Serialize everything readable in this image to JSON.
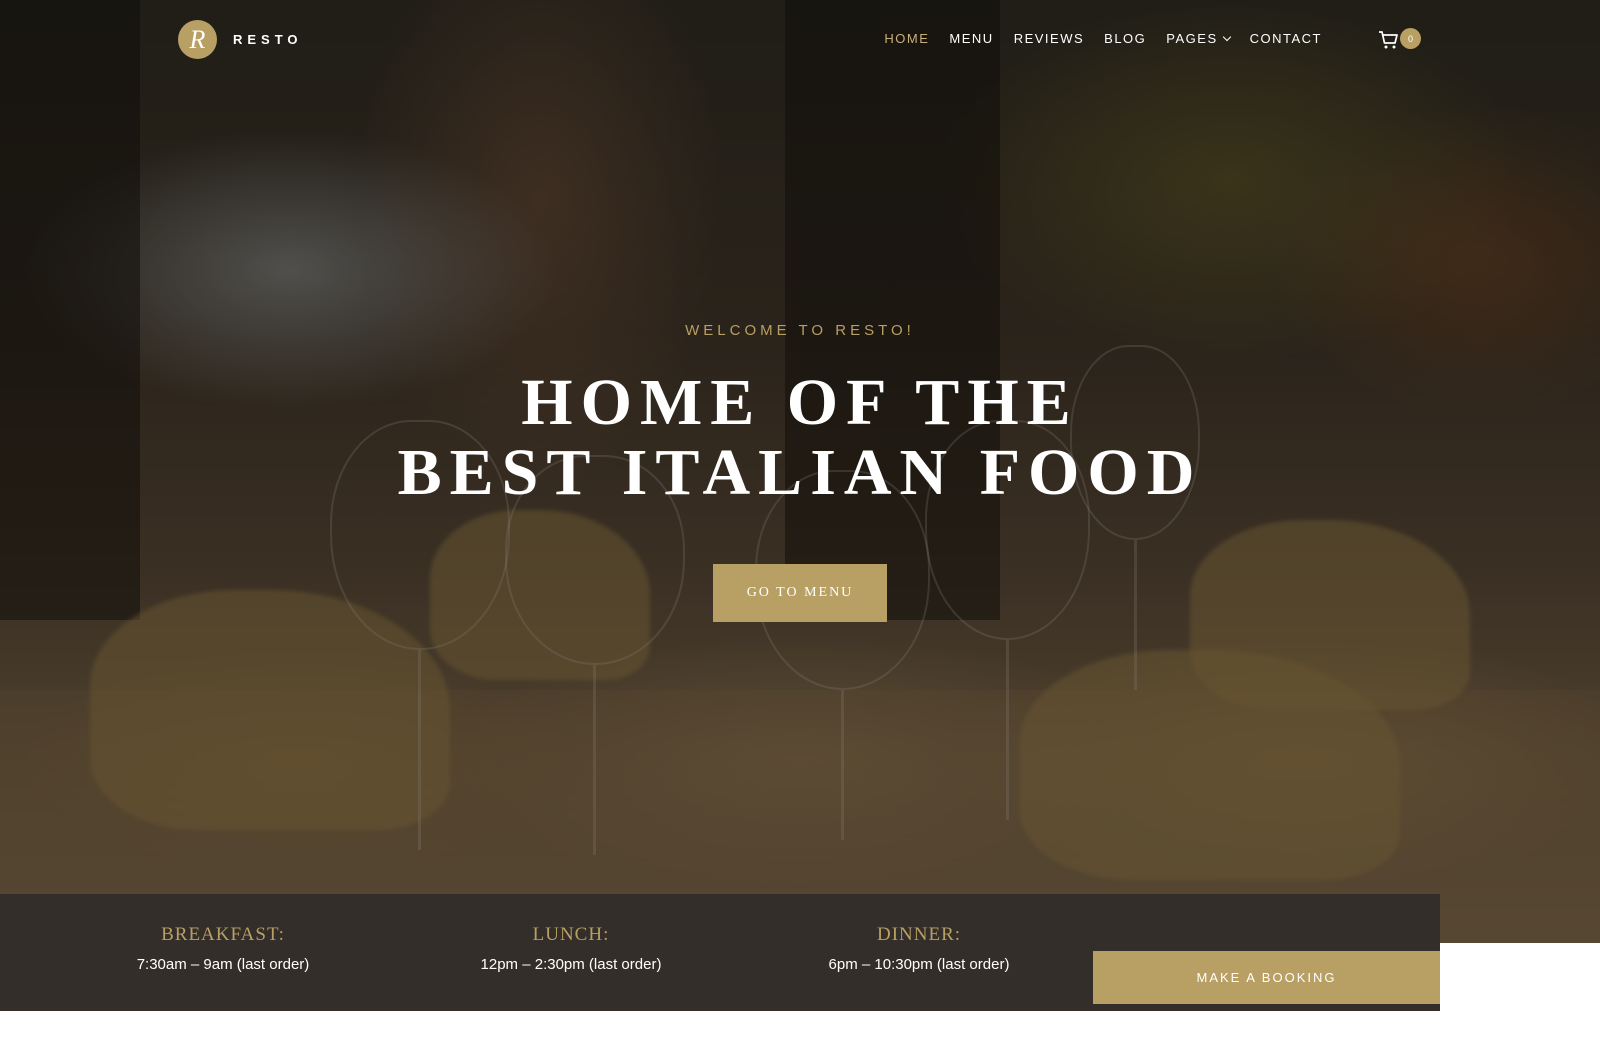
{
  "brand": {
    "logo_letter": "R",
    "name": "RESTO",
    "accent_color": "#b89f63"
  },
  "nav": {
    "items": [
      {
        "label": "HOME",
        "active": true
      },
      {
        "label": "MENU",
        "active": false
      },
      {
        "label": "REVIEWS",
        "active": false
      },
      {
        "label": "BLOG",
        "active": false
      },
      {
        "label": "PAGES",
        "active": false,
        "has_dropdown": true
      },
      {
        "label": "CONTACT",
        "active": false
      }
    ],
    "cart": {
      "icon": "cart-icon",
      "count": "0"
    }
  },
  "hero": {
    "eyebrow": "WELCOME TO RESTO!",
    "headline_line1": "HOME OF THE",
    "headline_line2": "BEST ITALIAN FOOD",
    "cta_label": "GO TO MENU"
  },
  "hours": {
    "items": [
      {
        "label": "BREAKFAST:",
        "value": "7:30am – 9am (last order)"
      },
      {
        "label": "LUNCH:",
        "value": "12pm – 2:30pm (last order)"
      },
      {
        "label": "DINNER:",
        "value": "6pm – 10:30pm (last order)"
      }
    ],
    "booking_label": "MAKE A BOOKING"
  }
}
